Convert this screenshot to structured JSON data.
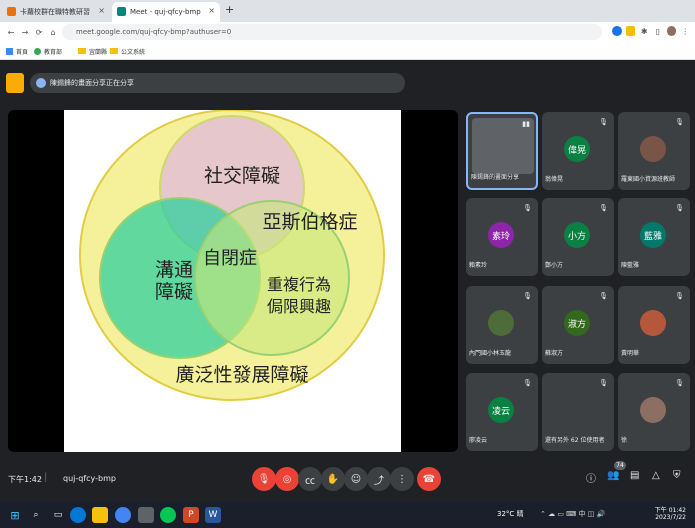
{
  "browser": {
    "tabs": [
      {
        "title": "卡蘿校群在職特教研習"
      },
      {
        "title": "Meet - quj-qfcy-bmp"
      }
    ],
    "url": "meet.google.com/quj-qfcy-bmp?authuser=0",
    "bookmarks": [
      "首頁",
      "教育部",
      "宜蘭縣",
      "公文系統"
    ]
  },
  "meet": {
    "banner": "陳錫鋒的畫面分享正在分享",
    "slide": {
      "circles": [
        "社交障礙",
        "溝通障礙",
        "重複行為侷限興趣"
      ],
      "center": "自閉症",
      "aspergers": "亞斯伯格症",
      "outer": "廣泛性發展障礙"
    },
    "participants": [
      {
        "name": "陳錫鋒的畫面分享",
        "avatar": "",
        "color": "#5f6368"
      },
      {
        "name": "翁偉晃",
        "avatar": "偉晃",
        "color": "#0b8043"
      },
      {
        "name": "羅東國小資源班教師",
        "avatar": "",
        "color": "#795548"
      },
      {
        "name": "賴素玲",
        "avatar": "素玲",
        "color": "#8e24aa"
      },
      {
        "name": "鄭小方",
        "avatar": "小方",
        "color": "#0b8043"
      },
      {
        "name": "陳藍雅",
        "avatar": "藍雅",
        "color": "#00796b"
      },
      {
        "name": "內門國小林玉龍",
        "avatar": "",
        "color": "#4e6b3a"
      },
      {
        "name": "蘇淑方",
        "avatar": "淑方",
        "color": "#33691e"
      },
      {
        "name": "黃明華",
        "avatar": "",
        "color": "#b5573b"
      },
      {
        "name": "廖凌云",
        "avatar": "凌云",
        "color": "#0b8043"
      },
      {
        "name": "還有另外 62 位使用者",
        "avatar": "",
        "color": "#3c4043"
      },
      {
        "name": "徐",
        "avatar": "",
        "color": "#8d6e63"
      }
    ],
    "time": "下午1:42",
    "code": "quj-qfcy-bmp",
    "count": "74"
  },
  "taskbar": {
    "weather": "32°C 晴",
    "time": "下午 01:42",
    "date": "2023/7/22"
  }
}
